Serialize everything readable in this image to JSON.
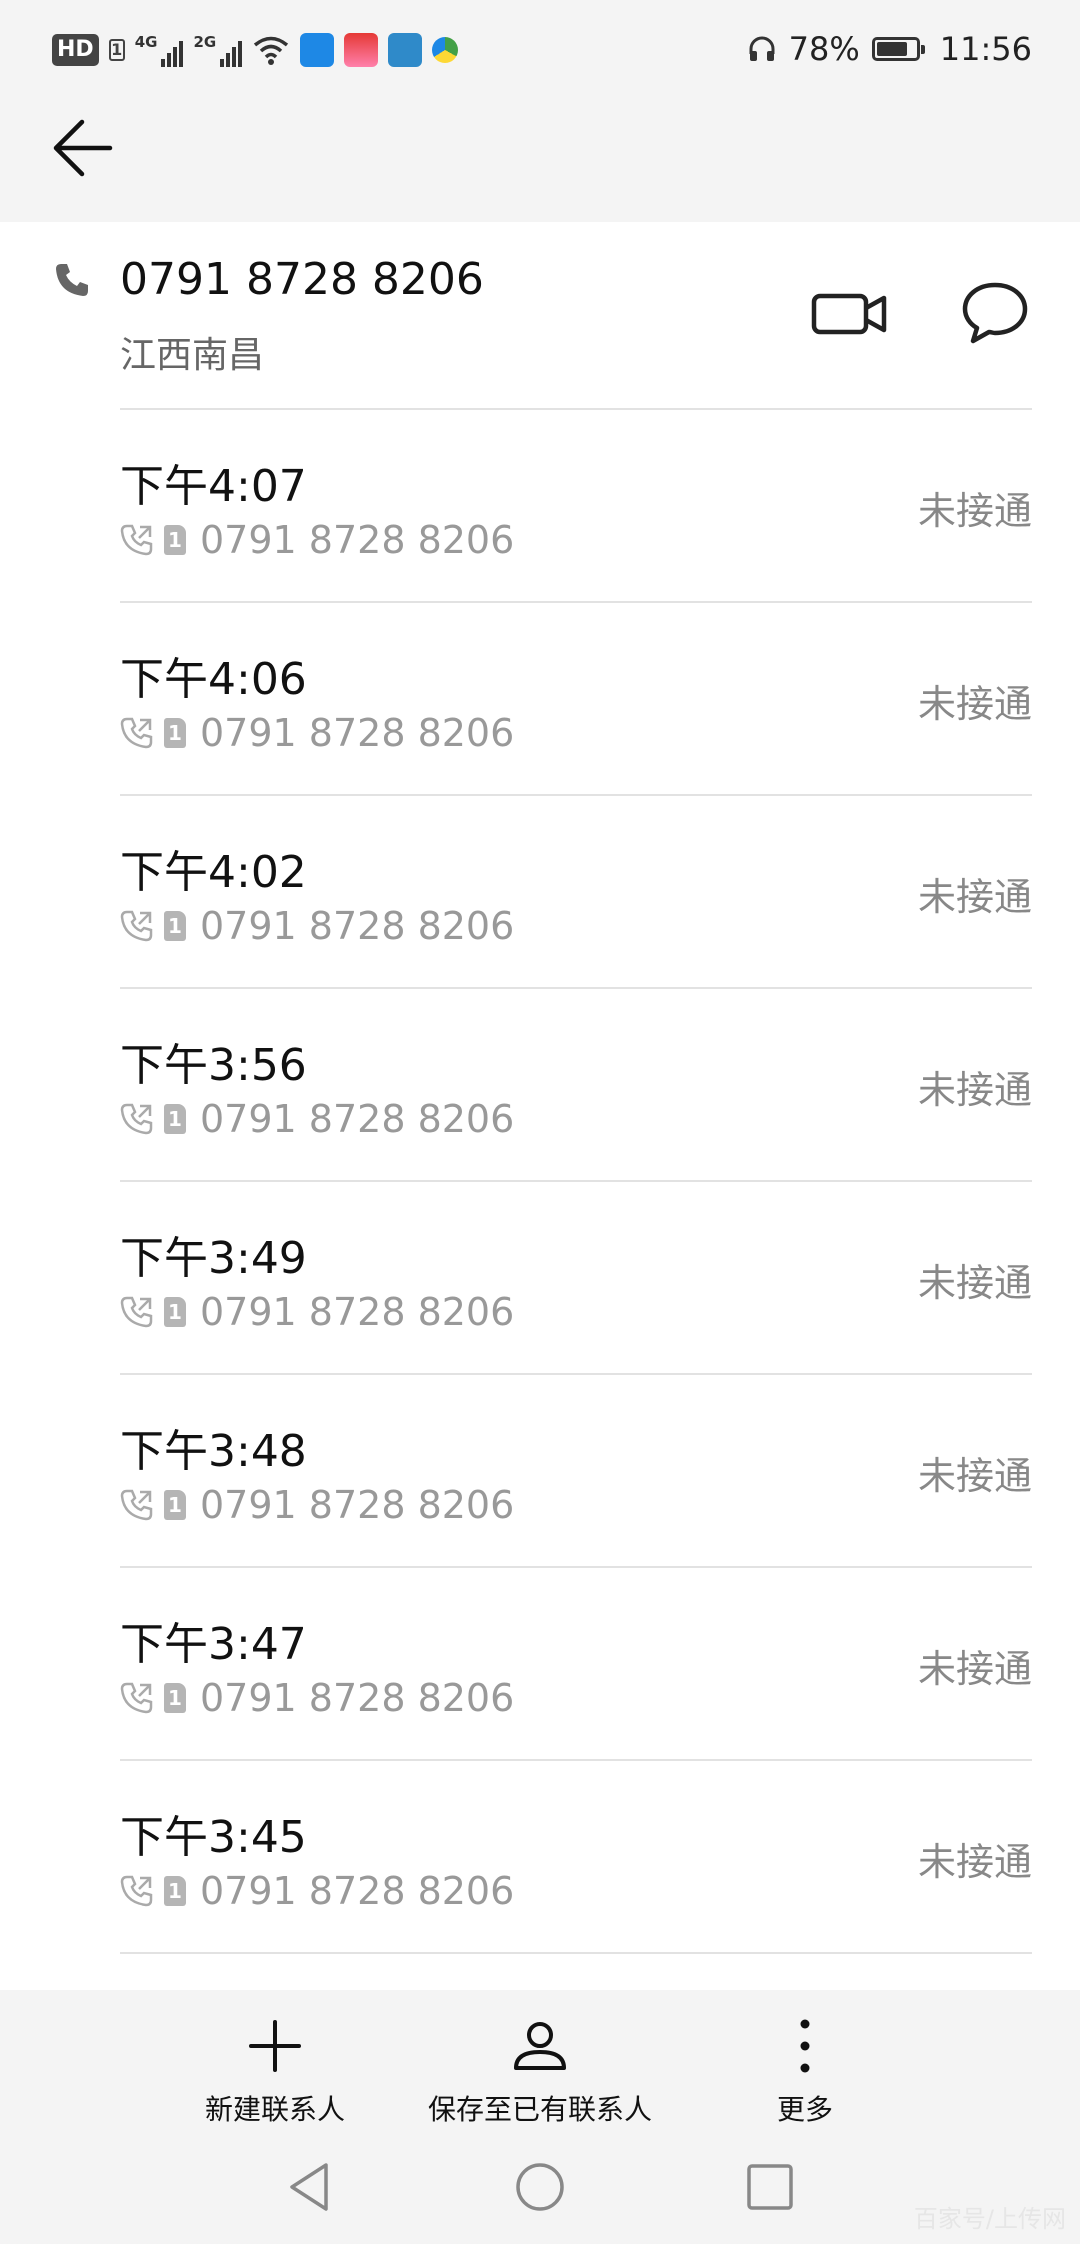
{
  "status_bar": {
    "hd": "HD",
    "sim1": "1",
    "net1": "4G",
    "net2": "2G",
    "battery_percent": "78%",
    "battery_level": 0.78,
    "time": "11:56",
    "icons": [
      "hd-icon",
      "signal-4g-icon",
      "signal-2g-icon",
      "wifi-icon",
      "app-icon-1",
      "app-icon-2",
      "app-icon-3",
      "app-icon-4",
      "headset-icon",
      "battery-icon"
    ]
  },
  "header": {
    "back_icon": "arrow-left-icon"
  },
  "contact": {
    "number": "0791 8728 8206",
    "location": "江西南昌",
    "icons": [
      "phone-icon",
      "video-call-icon",
      "message-icon"
    ]
  },
  "calls": [
    {
      "time": "下午4:07",
      "number": "0791 8728 8206",
      "status": "未接通",
      "sim": "1"
    },
    {
      "time": "下午4:06",
      "number": "0791 8728 8206",
      "status": "未接通",
      "sim": "1"
    },
    {
      "time": "下午4:02",
      "number": "0791 8728 8206",
      "status": "未接通",
      "sim": "1"
    },
    {
      "time": "下午3:56",
      "number": "0791 8728 8206",
      "status": "未接通",
      "sim": "1"
    },
    {
      "time": "下午3:49",
      "number": "0791 8728 8206",
      "status": "未接通",
      "sim": "1"
    },
    {
      "time": "下午3:48",
      "number": "0791 8728 8206",
      "status": "未接通",
      "sim": "1"
    },
    {
      "time": "下午3:47",
      "number": "0791 8728 8206",
      "status": "未接通",
      "sim": "1"
    },
    {
      "time": "下午3:45",
      "number": "0791 8728 8206",
      "status": "未接通",
      "sim": "1"
    }
  ],
  "actions": {
    "new_contact": "新建联系人",
    "save_existing": "保存至已有联系人",
    "more": "更多"
  },
  "watermark": "百家号/上传网"
}
